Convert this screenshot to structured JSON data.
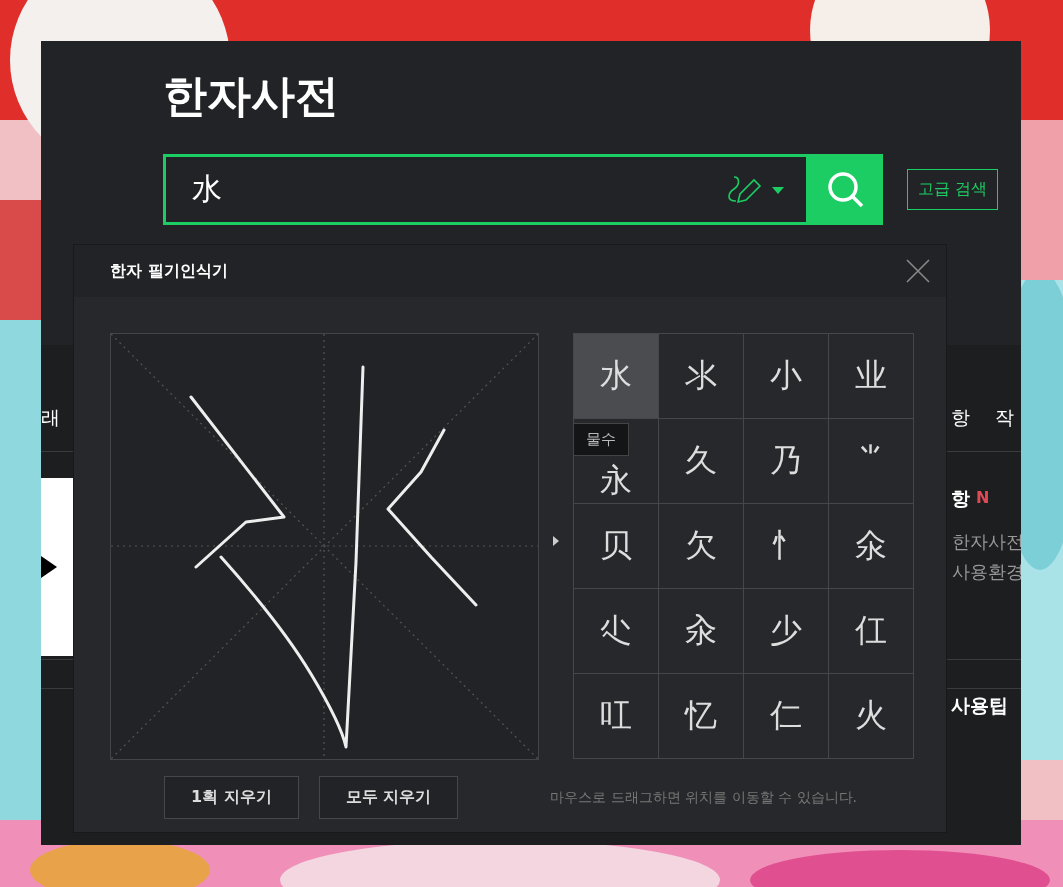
{
  "page": {
    "title": "한자사전",
    "search": {
      "value": "水"
    },
    "advanced_button": "고급 검색"
  },
  "background_content": {
    "tab_fragments": [
      "래",
      "항",
      "작"
    ],
    "notice": {
      "title": "항",
      "badge": "N",
      "lines": [
        "한자사전",
        "사용환경"
      ]
    },
    "tip_title": "사용팁"
  },
  "handwriting_panel": {
    "title": "한자 필기인식기",
    "candidates": [
      {
        "char": "水",
        "selected": true
      },
      {
        "char": "氺",
        "selected": false
      },
      {
        "char": "小",
        "selected": false
      },
      {
        "char": "业",
        "selected": false
      },
      {
        "char": "永",
        "selected": false
      },
      {
        "char": "久",
        "selected": false
      },
      {
        "char": "乃",
        "selected": false
      },
      {
        "char": "⺌",
        "selected": false
      },
      {
        "char": "贝",
        "selected": false
      },
      {
        "char": "欠",
        "selected": false
      },
      {
        "char": "忄",
        "selected": false
      },
      {
        "char": "氽",
        "selected": false
      },
      {
        "char": "尐",
        "selected": false
      },
      {
        "char": "汆",
        "selected": false
      },
      {
        "char": "少",
        "selected": false
      },
      {
        "char": "仜",
        "selected": false
      },
      {
        "char": "叿",
        "selected": false
      },
      {
        "char": "忆",
        "selected": false
      },
      {
        "char": "仁",
        "selected": false
      },
      {
        "char": "火",
        "selected": false
      }
    ],
    "tooltip": "물수",
    "buttons": [
      "1획 지우기",
      "모두 지우기"
    ],
    "hint": "마우스로 드래그하면 위치를 이동할 수 있습니다."
  }
}
